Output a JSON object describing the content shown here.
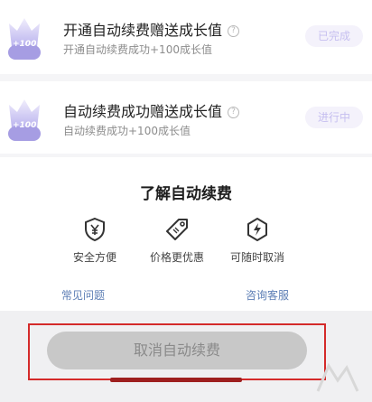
{
  "tasks": [
    {
      "title": "开通自动续费赠送成长值",
      "desc": "开通自动续费成功+100成长值",
      "status": "已完成",
      "badge_text": "+100"
    },
    {
      "title": "自动续费成功赠送成长值",
      "desc": "自动续费成功+100成长值",
      "status": "进行中",
      "badge_text": "+100"
    }
  ],
  "help_icon_glyph": "?",
  "info": {
    "title": "了解自动续费",
    "features": [
      {
        "label": "安全方便",
        "icon": "shield-yen-icon"
      },
      {
        "label": "价格更优惠",
        "icon": "price-tag-icon"
      },
      {
        "label": "可随时取消",
        "icon": "lightning-badge-icon"
      }
    ],
    "links": {
      "faq": "常见问题",
      "support": "咨询客服"
    }
  },
  "cancel_button": "取消自动续费",
  "colors": {
    "accent_purple": "#b9b2ee",
    "pill_text": "#c6bff0",
    "link_blue": "#5c7eb5",
    "highlight_red": "#d42a2a"
  }
}
